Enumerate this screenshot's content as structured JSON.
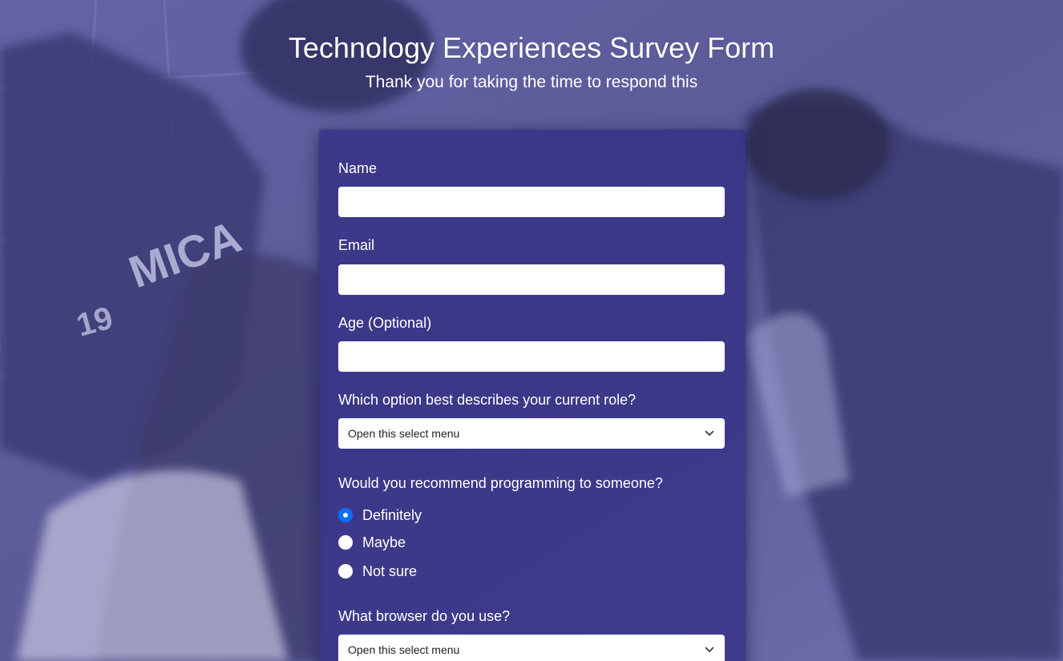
{
  "header": {
    "title": "Technology Experiences Survey Form",
    "subtitle": "Thank you for taking the time to respond this"
  },
  "form": {
    "name": {
      "label": "Name",
      "value": ""
    },
    "email": {
      "label": "Email",
      "value": ""
    },
    "age": {
      "label": "Age (Optional)",
      "value": ""
    },
    "role": {
      "label": "Which option best describes your current role?",
      "selected": "Open this select menu"
    },
    "recommend": {
      "label": "Would you recommend programming to someone?",
      "options": [
        {
          "label": "Definitely",
          "checked": true
        },
        {
          "label": "Maybe",
          "checked": false
        },
        {
          "label": "Not sure",
          "checked": false
        }
      ]
    },
    "browser": {
      "label": "What browser do you use?",
      "selected": "Open this select menu"
    }
  },
  "background": {
    "text_on_shirt": "MICA",
    "number_on_shirt": "19"
  },
  "colors": {
    "overlay": "#5d5c9a",
    "card": "#343084",
    "radio_checked": "#0d6efd",
    "text": "#ffffff"
  },
  "icons": {
    "select_chevron": "chevron-down-icon"
  }
}
